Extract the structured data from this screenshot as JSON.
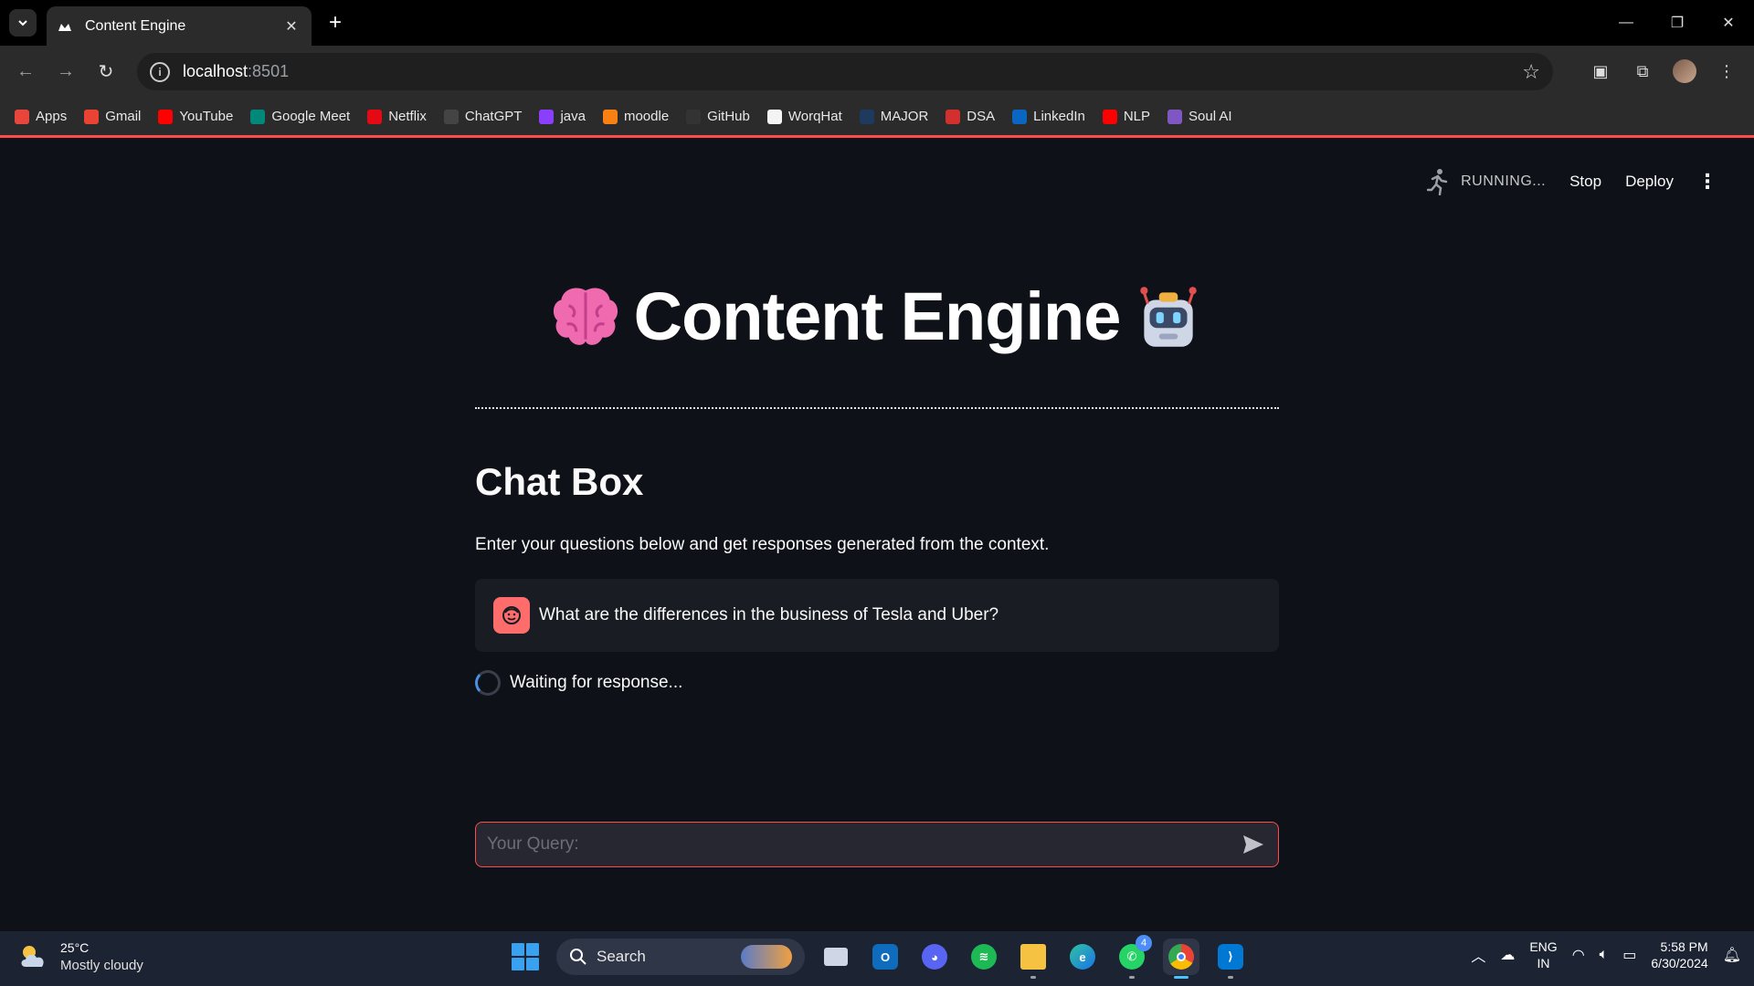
{
  "browser": {
    "tab_title": "Content Engine",
    "url_host": "localhost",
    "url_port": ":8501",
    "bookmarks": [
      {
        "label": "Apps",
        "icon": "apps-grid-icon",
        "color": "#e8453c"
      },
      {
        "label": "Gmail",
        "icon": "gmail-icon",
        "color": "#ea4335"
      },
      {
        "label": "YouTube",
        "icon": "youtube-icon",
        "color": "#ff0000"
      },
      {
        "label": "Google Meet",
        "icon": "google-meet-icon",
        "color": "#00897b"
      },
      {
        "label": "Netflix",
        "icon": "netflix-icon",
        "color": "#e50914"
      },
      {
        "label": "ChatGPT",
        "icon": "chatgpt-icon",
        "color": "#444"
      },
      {
        "label": "java",
        "icon": "java-icon",
        "color": "#8a3ffc"
      },
      {
        "label": "moodle",
        "icon": "moodle-icon",
        "color": "#f98012"
      },
      {
        "label": "GitHub",
        "icon": "github-icon",
        "color": "#333"
      },
      {
        "label": "WorqHat",
        "icon": "worqhat-icon",
        "color": "#f4f4f4"
      },
      {
        "label": "MAJOR",
        "icon": "major-icon",
        "color": "#1e3a5f"
      },
      {
        "label": "DSA",
        "icon": "dsa-icon",
        "color": "#d32f2f"
      },
      {
        "label": "LinkedIn",
        "icon": "linkedin-icon",
        "color": "#0a66c2"
      },
      {
        "label": "NLP",
        "icon": "youtube-icon",
        "color": "#ff0000"
      },
      {
        "label": "Soul AI",
        "icon": "soul-ai-icon",
        "color": "#7e57c2"
      }
    ]
  },
  "app": {
    "status_text": "RUNNING...",
    "stop_label": "Stop",
    "deploy_label": "Deploy",
    "title": "Content Engine",
    "chat_heading": "Chat Box",
    "chat_description": "Enter your questions below and get responses generated from the context.",
    "user_message": "What are the differences in the business of Tesla and Uber?",
    "waiting_text": "Waiting for response...",
    "input_placeholder": "Your Query:",
    "accent_color": "#ff4b4b"
  },
  "taskbar": {
    "weather_temp": "25°C",
    "weather_desc": "Mostly cloudy",
    "search_label": "Search",
    "whatsapp_badge": "4",
    "lang_top": "ENG",
    "lang_bottom": "IN",
    "time": "5:58 PM",
    "date": "6/30/2024"
  }
}
